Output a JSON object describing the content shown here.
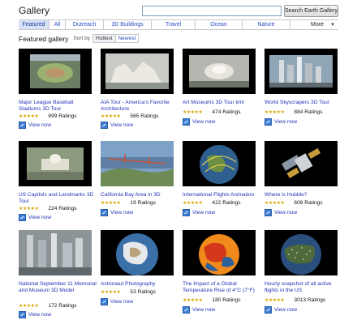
{
  "header": {
    "title": "Gallery",
    "search_value": "",
    "search_button": "Search Earth Gallery"
  },
  "tabs": [
    {
      "label": "Featured",
      "selected": true
    },
    {
      "label": "All"
    },
    {
      "label": "Outreach"
    },
    {
      "label": "3D Buildings"
    },
    {
      "label": "Travel"
    },
    {
      "label": "Ocean"
    },
    {
      "label": "Nature"
    },
    {
      "label": "More"
    }
  ],
  "subbar": {
    "section_title": "Featured gallery",
    "sort_by_label": "Sort by",
    "sort_options": [
      "Hottest",
      "Newest"
    ]
  },
  "view_now_label": "View now",
  "star_glyphs": "★★★★★",
  "gallery": [
    {
      "title": "Major League Baseball Stadiums 3D Tour",
      "ratings": "899 Ratings",
      "thumb": "stadium"
    },
    {
      "title": "AIA Tour - America's Favorite Architecture",
      "ratings": "565 Ratings",
      "thumb": "architecture"
    },
    {
      "title": "Art Museums 3D Tour kml",
      "ratings": "474 Ratings",
      "thumb": "museum"
    },
    {
      "title": "World Skyscrapers 3D Tour",
      "ratings": "884 Ratings",
      "thumb": "skyscrapers"
    },
    {
      "title": "US Capitols and Landmarks 3D Tour",
      "ratings": "224 Ratings",
      "thumb": "capitol"
    },
    {
      "title": "California Bay Area in 3D",
      "ratings": "19 Ratings",
      "thumb": "bay"
    },
    {
      "title": "International Flights Animation",
      "ratings": "422 Ratings",
      "thumb": "flights"
    },
    {
      "title": "Where is Hubble?",
      "ratings": "608 Ratings",
      "thumb": "hubble"
    },
    {
      "title": "National September 11 Memorial and Museum 3D Model",
      "ratings": "172 Ratings",
      "thumb": "memorial"
    },
    {
      "title": "Astronaut Photography",
      "ratings": "53 Ratings",
      "thumb": "astronaut"
    },
    {
      "title": "The Impact of a Global Temperature Rise of 4°C (7°F)",
      "ratings": "180 Ratings",
      "thumb": "temperature"
    },
    {
      "title": "Hourly snapshot of all active flights in the US",
      "ratings": "3013 Ratings",
      "thumb": "hourly"
    }
  ]
}
